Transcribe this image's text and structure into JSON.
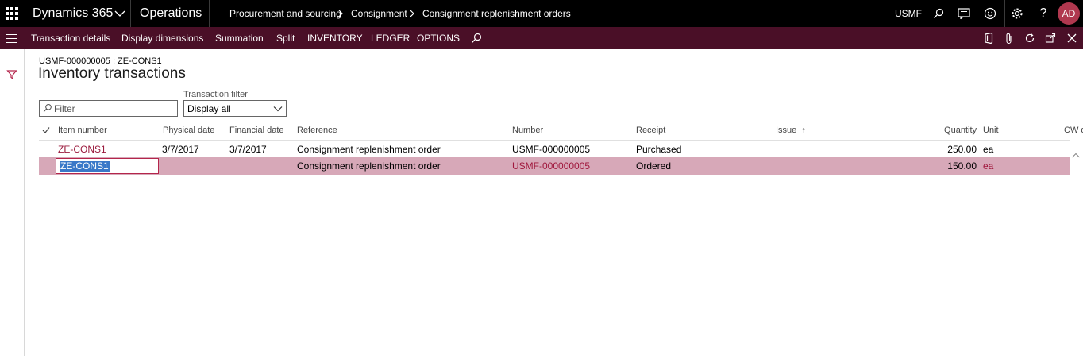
{
  "topbar": {
    "app_name": "Dynamics 365",
    "module": "Operations",
    "breadcrumb": [
      "Procurement and sourcing",
      "Consignment",
      "Consignment replenishment orders"
    ],
    "company": "USMF",
    "icons": [
      "search-icon",
      "message-icon",
      "smiley-icon",
      "gear-icon",
      "help-icon"
    ],
    "help_label": "?",
    "user_initials": "AD"
  },
  "actionpane": {
    "items": [
      "Transaction details",
      "Display dimensions",
      "Summation",
      "Split",
      "INVENTORY",
      "LEDGER",
      "OPTIONS"
    ],
    "right_icons": [
      "office-icon",
      "attachment-icon",
      "refresh-icon",
      "popout-icon",
      "close-icon"
    ]
  },
  "page": {
    "caption": "USMF-000000005 : ZE-CONS1",
    "title": "Inventory transactions",
    "filter_placeholder": "Filter",
    "transaction_filter_label": "Transaction filter",
    "transaction_filter_value": "Display all"
  },
  "grid": {
    "columns": [
      "Item number",
      "Physical date",
      "Financial date",
      "Reference",
      "Number",
      "Receipt",
      "Issue",
      "Quantity",
      "Unit",
      "CW q"
    ],
    "sort_indicator": "↑",
    "rows": [
      {
        "item": "ZE-CONS1",
        "physical_date": "3/7/2017",
        "financial_date": "3/7/2017",
        "reference": "Consignment replenishment order",
        "number": "USMF-000000005",
        "receipt": "Purchased",
        "issue": "",
        "quantity": "250.00",
        "unit": "ea"
      },
      {
        "item": "ZE-CONS1",
        "physical_date": "",
        "financial_date": "",
        "reference": "Consignment replenishment order",
        "number": "USMF-000000005",
        "receipt": "Ordered",
        "issue": "",
        "quantity": "150.00",
        "unit": "ea"
      }
    ]
  },
  "colors": {
    "topbar": "#000000",
    "actionpane": "#4a0f27",
    "selected_row": "#d7a8b8",
    "link": "#9b1b3e",
    "avatar": "#b0384f"
  }
}
